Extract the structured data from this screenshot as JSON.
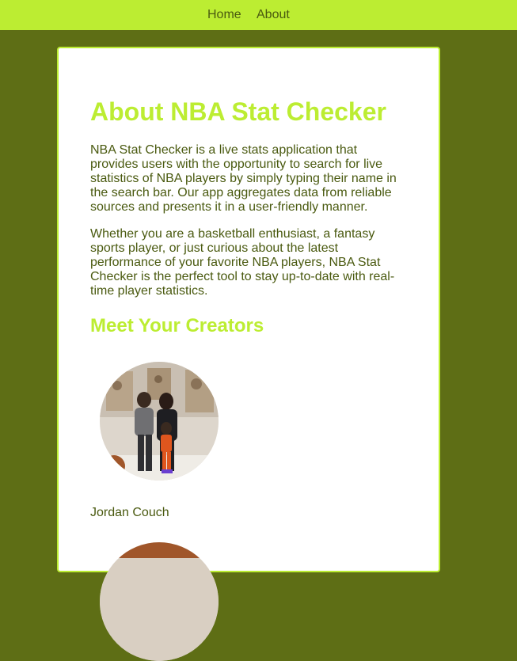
{
  "nav": {
    "home": "Home",
    "about": "About"
  },
  "about": {
    "title": "About NBA Stat Checker",
    "paragraph_1": "NBA Stat Checker is a live stats application that provides users with the opportunity to search for live statistics of NBA players by simply typing their name in the search bar. Our app aggregates data from reliable sources and presents it in a user-friendly manner.",
    "paragraph_2": "Whether you are a basketball enthusiast, a fantasy sports player, or just curious about the latest performance of your favorite NBA players, NBA Stat Checker is the perfect tool to stay up-to-date with real-time player statistics."
  },
  "creators": {
    "title": "Meet Your Creators",
    "items": [
      {
        "name": "Jordan Couch"
      }
    ]
  },
  "colors": {
    "page_background": "#5e6e15",
    "nav_background": "#bced32",
    "accent": "#bced32",
    "text": "#4a5a10",
    "card_background": "#ffffff"
  }
}
